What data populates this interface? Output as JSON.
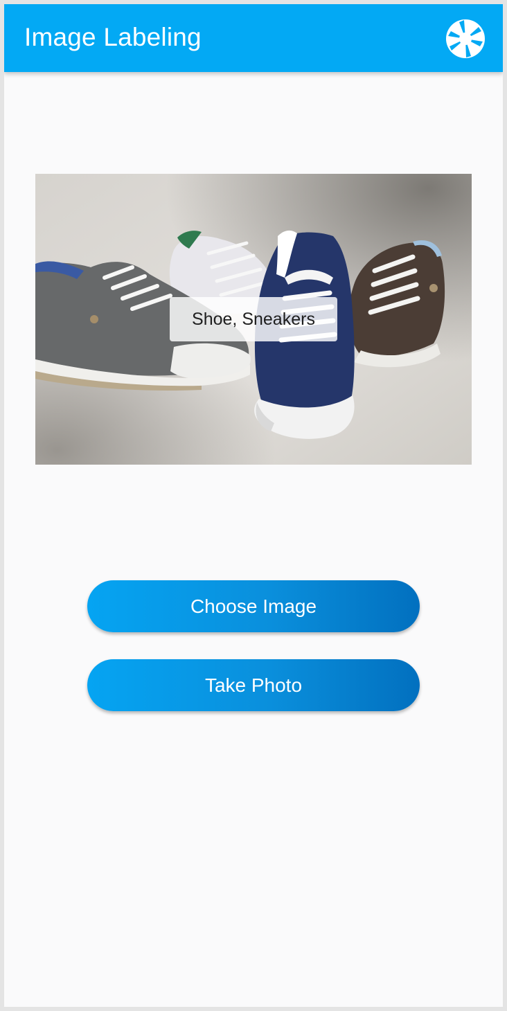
{
  "appbar": {
    "title": "Image Labeling",
    "icon": "camera-shutter-icon",
    "background_color": "#03a9f4"
  },
  "preview": {
    "image_subject": "four canvas sneakers (grey, white, navy, brown) with white toe caps",
    "detected_labels": "Shoe, Sneakers"
  },
  "actions": {
    "choose_image_label": "Choose Image",
    "take_photo_label": "Take Photo",
    "button_gradient": [
      "#05a4f2",
      "#0270bf"
    ]
  }
}
